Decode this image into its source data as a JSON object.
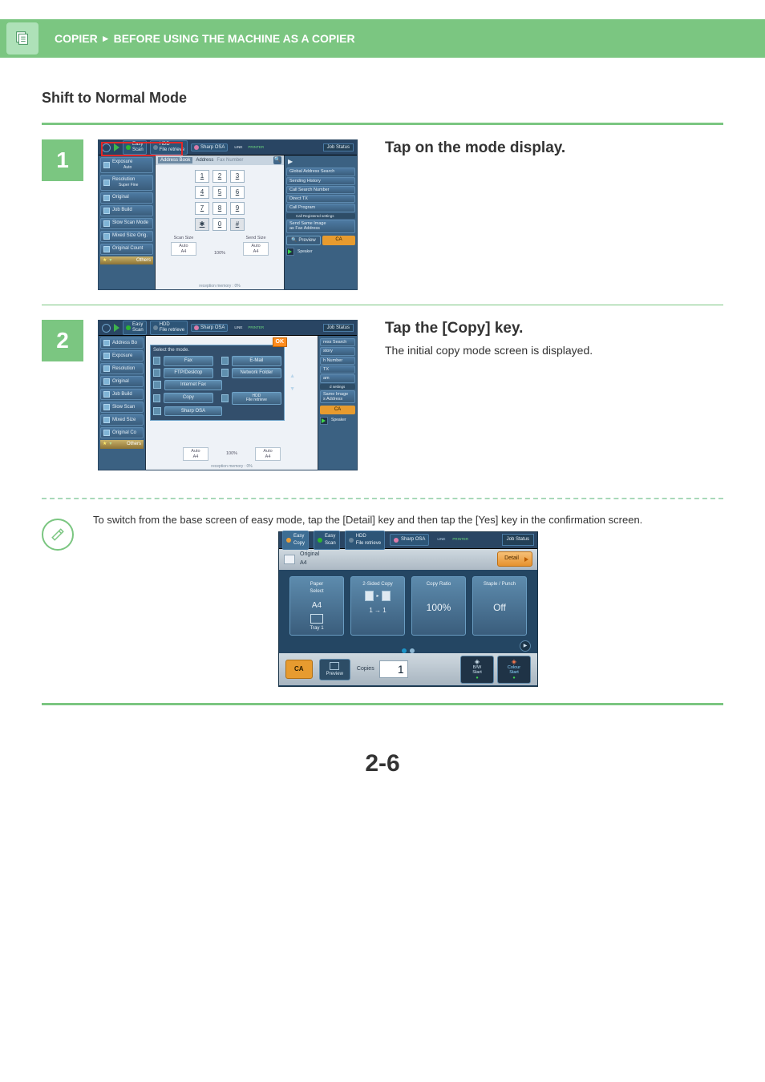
{
  "header": {
    "breadcrumb1": "COPIER",
    "breadcrumb2": "BEFORE USING THE MACHINE AS A COPIER"
  },
  "section_title": "Shift to Normal Mode",
  "step1": {
    "num": "1",
    "title": "Tap on the mode display.",
    "top": {
      "easy_scan": "Easy\nScan",
      "hdd": "HDD\nFile retrieve",
      "sharp": "Sharp OSA",
      "line": "LINE",
      "printer": "PRINTER",
      "job": "Job Status"
    },
    "addr": {
      "book": "Address Book",
      "addr": "Address",
      "field_label": "Fax Number"
    },
    "side": [
      "Exposure",
      "Resolution",
      "Original",
      "Job Build",
      "Slow Scan Mode",
      "Mixed Size Orig.",
      "Original Count"
    ],
    "side_vals": [
      "Auto",
      "Super Fine"
    ],
    "others": "Others",
    "keypad": [
      "1",
      "2",
      "3",
      "4",
      "5",
      "6",
      "7",
      "8",
      "9",
      "✱",
      "0",
      "#"
    ],
    "scan": {
      "scan_label": "Scan Size",
      "send_label": "Send Size",
      "auto": "Auto",
      "a4": "A4",
      "pct": "100%"
    },
    "rx": "reception memory :     0%",
    "right": {
      "play": "▶",
      "global": "Global Address Search",
      "hist": "Sending History",
      "callnum": "Call Search Number",
      "direct": "Direct TX",
      "prog": "Call Program",
      "prog_sub": "Call Registered settings",
      "same": "Send Same Image\nas Fax Address",
      "preview": "Preview",
      "ca": "CA",
      "spk": "Speaker"
    }
  },
  "step2": {
    "num": "2",
    "title": "Tap the [Copy] key.",
    "text": "The initial copy mode screen is displayed.",
    "ovl": {
      "hdr": "Select the mode.",
      "ok": "OK",
      "fax": "Fax",
      "email": "E-Mail",
      "ftp": "FTP/Desktop",
      "net": "Network Folder",
      "ifax": "Internet Fax",
      "copy": "Copy",
      "hdd": "HDD\nFile retrieve",
      "sharp": "Sharp OSA"
    },
    "right_partial": {
      "search": "ress Search",
      "story": "story",
      "hnum": "h Number",
      "tx": "TX",
      "am": "am",
      "settings": "d settings",
      "same": "Same Image\ns Address"
    }
  },
  "note": {
    "text": "To switch from the base screen of easy mode, tap the [Detail] key and then tap the [Yes] key in the confirmation screen."
  },
  "shot3": {
    "top": {
      "ecopy": "Easy\nCopy",
      "escan": "Easy\nScan",
      "hdd": "HDD\nFile retrieve",
      "sharp": "Sharp OSA",
      "line": "LINE",
      "printer": "PRINTER",
      "job": "Job Status"
    },
    "orig_lbl": "Original",
    "orig_val": "A4",
    "detail": "Detail",
    "tiles": [
      {
        "label": "Paper\nSelect",
        "v1": "A4",
        "v2": "Tray 1"
      },
      {
        "label": "2-Sided Copy",
        "v1": "1 → 1"
      },
      {
        "label": "Copy Ratio",
        "v1": "100%"
      },
      {
        "label": "Staple / Punch",
        "v1": "Off"
      }
    ],
    "ca": "CA",
    "preview": "Preview",
    "copies_lbl": "Copies",
    "copies": "1",
    "bw": "B/W\nStart",
    "col": "Colour\nStart"
  },
  "page": "2-6"
}
